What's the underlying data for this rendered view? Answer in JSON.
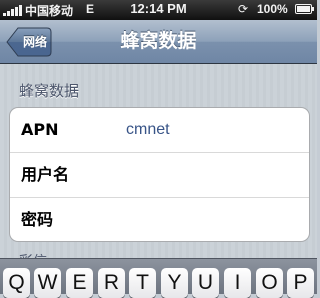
{
  "status_bar": {
    "carrier": "中国移动",
    "network": "E",
    "time": "12:14 PM",
    "battery_percent": "100%",
    "sync_icon": "sync-icon",
    "battery_level": 1.0,
    "signal_bars": 5
  },
  "nav_bar": {
    "back_label": "网络",
    "title": "蜂窝数据"
  },
  "section": {
    "header": "蜂窝数据",
    "rows": [
      {
        "label": "APN",
        "value": "cmnet"
      },
      {
        "label": "用户名",
        "value": ""
      },
      {
        "label": "密码",
        "value": ""
      }
    ],
    "next_header_partial": "彩信"
  },
  "keyboard": {
    "keys": [
      "Q",
      "W",
      "E",
      "R",
      "T",
      "Y",
      "U",
      "I",
      "O",
      "P"
    ]
  },
  "colors": {
    "nav_bar": "#8da1b9",
    "value_text": "#385487",
    "background": "#c5ccd4"
  }
}
